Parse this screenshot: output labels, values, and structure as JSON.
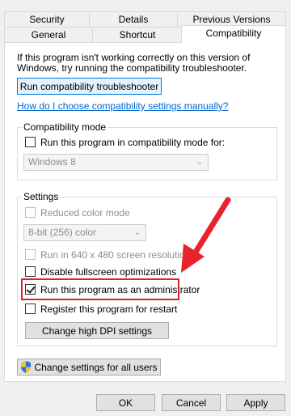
{
  "tabs_row1": [
    {
      "label": "Security"
    },
    {
      "label": "Details"
    },
    {
      "label": "Previous Versions"
    }
  ],
  "tabs_row2": [
    {
      "label": "General"
    },
    {
      "label": "Shortcut"
    },
    {
      "label": "Compatibility",
      "active": true
    }
  ],
  "intro_text": "If this program isn't working correctly on this version of Windows, try running the compatibility troubleshooter.",
  "troubleshooter_button": "Run compatibility troubleshooter",
  "help_link": "How do I choose compatibility settings manually?",
  "compat_mode": {
    "title": "Compatibility mode",
    "checkbox_label": "Run this program in compatibility mode for:",
    "checked": false,
    "select_value": "Windows 8"
  },
  "settings": {
    "title": "Settings",
    "reduced_color": {
      "label": "Reduced color mode",
      "checked": false,
      "disabled": true
    },
    "color_select_value": "8-bit (256) color",
    "resolution": {
      "label": "Run in 640 x 480 screen resolution",
      "checked": false,
      "disabled": true
    },
    "fullscreen_opt": {
      "label": "Disable fullscreen optimizations",
      "checked": false
    },
    "run_as_admin": {
      "label": "Run this program as an administrator",
      "checked": true
    },
    "register_restart": {
      "label": "Register this program for restart",
      "checked": false
    },
    "dpi_button": "Change high DPI settings"
  },
  "all_users_button": "Change settings for all users",
  "footer": {
    "ok": "OK",
    "cancel": "Cancel",
    "apply": "Apply"
  },
  "colors": {
    "highlight_box": "#d9232c",
    "arrow": "#e8232c",
    "link": "#0066cc"
  }
}
